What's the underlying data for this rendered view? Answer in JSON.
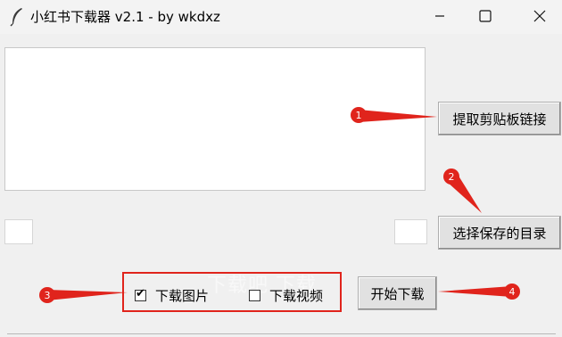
{
  "window": {
    "title": "小红书下载器 v2.1 - by wkdxz",
    "app_icon": "feather-icon",
    "controls": [
      "minimize-icon",
      "maximize-icon",
      "close-icon"
    ]
  },
  "main": {
    "link_textbox_value": "",
    "extract_clipboard_button": "提取剪贴板链接",
    "choose_dir_button": "选择保存的目录",
    "start_download_button": "开始下载",
    "download_images": {
      "label": "下载图片",
      "checked": true
    },
    "download_videos": {
      "label": "下载视频",
      "checked": false
    }
  },
  "watermark": "下载吧 下载",
  "annotations": {
    "color": "#e0241c",
    "markers": [
      "1",
      "2",
      "3",
      "4"
    ]
  }
}
